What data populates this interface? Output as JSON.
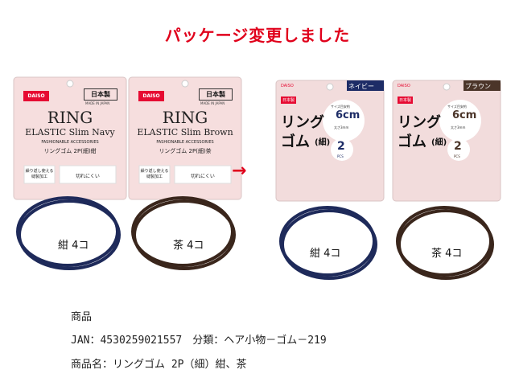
{
  "headline": {
    "text": "パッケージ変更しました",
    "color": "#e0001b"
  },
  "arrow_glyph": "→",
  "old_packages": [
    {
      "brand": "DAISO",
      "badge": "日本製",
      "made_in": "MADE IN JAPAN",
      "title": "RING",
      "subtitle": "ELASTIC Slim Navy",
      "accessories": "FASHIONABLE ACCESSORIES",
      "name_jp": "リングゴム 2P(細)紺",
      "feature1": "繰り返し使える縫製加工",
      "feature2": "切れにくい",
      "caption": "紺 4コ",
      "ring_color": "#1e2a5a"
    },
    {
      "brand": "DAISO",
      "badge": "日本製",
      "made_in": "MADE IN JAPAN",
      "title": "RING",
      "subtitle": "ELASTIC Slim Brown",
      "accessories": "FASHIONABLE ACCESSORIES",
      "name_jp": "リングゴム 2P(細)茶",
      "feature1": "繰り返し使える縫製加工",
      "feature2": "切れにくい",
      "caption": "茶 4コ",
      "ring_color": "#3a261c"
    }
  ],
  "new_packages": [
    {
      "brand": "DAISO",
      "badge": "日本製",
      "color_tag": "ネイビー",
      "tag_color": "#1d2c66",
      "title_line1": "リング",
      "title_line2": "ゴム",
      "title_paren": "(細)",
      "size_label": "サイズ目安約",
      "size_value": "6cm",
      "thickness": "太さ3mm",
      "count": "2",
      "count_unit": "PCS",
      "caption": "紺 4コ",
      "ring_color": "#1e2a5a"
    },
    {
      "brand": "DAISO",
      "badge": "日本製",
      "color_tag": "ブラウン",
      "tag_color": "#4b3529",
      "title_line1": "リング",
      "title_line2": "ゴム",
      "title_paren": "(細)",
      "size_label": "サイズ目安約",
      "size_value": "6cm",
      "thickness": "太さ3mm",
      "count": "2",
      "count_unit": "PCS",
      "caption": "茶 4コ",
      "ring_color": "#3a261c"
    }
  ],
  "info": {
    "section_label": "商品",
    "jan_line": "JAN：4530259021557　分類：ヘア小物－ゴム－219",
    "name_line": "商品名：リングゴム 2P（細）紺、茶"
  }
}
